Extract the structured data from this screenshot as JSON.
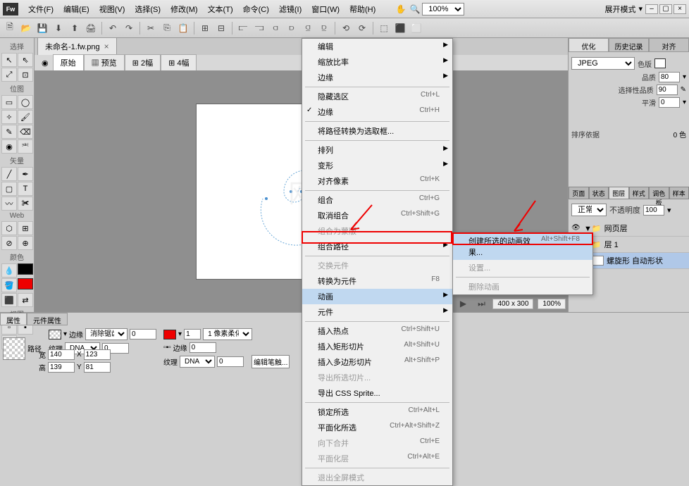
{
  "app": {
    "logo": "Fw"
  },
  "menubar": [
    "文件(F)",
    "编辑(E)",
    "视图(V)",
    "选择(S)",
    "修改(M)",
    "文本(T)",
    "命令(C)",
    "滤镜(I)",
    "窗口(W)",
    "帮助(H)"
  ],
  "titlebar_right": {
    "mode": "展开模式"
  },
  "zoom": "100%",
  "document": {
    "tab_name": "未命名-1.fw.png",
    "view_tabs": [
      "原始",
      "预览",
      "2幅",
      "4幅"
    ]
  },
  "left_sections": {
    "select": "选择",
    "bitmap": "位图",
    "vector": "矢量",
    "web": "Web",
    "colors": "颜色",
    "view": "视图"
  },
  "context_menu": [
    {
      "label": "编辑",
      "arrow": true
    },
    {
      "label": "缩放比率",
      "arrow": true
    },
    {
      "label": "边缘",
      "arrow": true
    },
    {
      "sep": true
    },
    {
      "label": "隐藏选区",
      "shortcut": "Ctrl+L"
    },
    {
      "label": "边缘",
      "shortcut": "Ctrl+H",
      "check": true
    },
    {
      "sep": true
    },
    {
      "label": "将路径转换为选取框..."
    },
    {
      "sep": true
    },
    {
      "label": "排列",
      "arrow": true
    },
    {
      "label": "变形",
      "arrow": true
    },
    {
      "label": "对齐像素",
      "shortcut": "Ctrl+K"
    },
    {
      "sep": true
    },
    {
      "label": "组合",
      "shortcut": "Ctrl+G"
    },
    {
      "label": "取消组合",
      "shortcut": "Ctrl+Shift+G"
    },
    {
      "label": "组合为蒙版",
      "disabled": true
    },
    {
      "label": "组合路径",
      "arrow": true
    },
    {
      "sep": true
    },
    {
      "label": "交换元件",
      "disabled": true
    },
    {
      "label": "转换为元件",
      "shortcut": "F8"
    },
    {
      "label": "动画",
      "arrow": true,
      "highlighted": true
    },
    {
      "label": "元件",
      "arrow": true
    },
    {
      "sep": true
    },
    {
      "label": "插入热点",
      "shortcut": "Ctrl+Shift+U"
    },
    {
      "label": "插入矩形切片",
      "shortcut": "Alt+Shift+U"
    },
    {
      "label": "插入多边形切片",
      "shortcut": "Alt+Shift+P"
    },
    {
      "label": "导出所选切片...",
      "disabled": true
    },
    {
      "label": "导出 CSS Sprite..."
    },
    {
      "sep": true
    },
    {
      "label": "锁定所选",
      "shortcut": "Ctrl+Alt+L"
    },
    {
      "label": "平面化所选",
      "shortcut": "Ctrl+Alt+Shift+Z"
    },
    {
      "label": "向下合并",
      "shortcut": "Ctrl+E",
      "disabled": true
    },
    {
      "label": "平面化层",
      "shortcut": "Ctrl+Alt+E",
      "disabled": true
    },
    {
      "sep": true
    },
    {
      "label": "退出全屏模式",
      "disabled": true
    }
  ],
  "submenu": [
    {
      "label": "创建所选的动画效果...",
      "shortcut": "Alt+Shift+F8",
      "highlighted": true
    },
    {
      "label": "设置...",
      "disabled": true
    },
    {
      "sep": true
    },
    {
      "label": "删除动画",
      "disabled": true
    }
  ],
  "right_panel": {
    "tabs": [
      "优化",
      "历史记录",
      "对齐"
    ],
    "format": "JPEG",
    "color_label": "色版",
    "quality_label": "品质",
    "quality": "80",
    "select_quality_label": "选择性品质",
    "select_quality": "90",
    "smooth_label": "平滑",
    "smooth": "0",
    "sort_label": "排序依据",
    "sort_colors": "0 色",
    "layer_tabs": [
      "页面",
      "状态",
      "图层",
      "样式",
      "调色板",
      "样本"
    ],
    "blend_mode": "正常",
    "opacity_label": "不透明度",
    "opacity": "100",
    "layers": [
      {
        "name": "网页层"
      },
      {
        "name": "层 1"
      },
      {
        "name": "螺旋形 自动形状"
      }
    ]
  },
  "bottom": {
    "tabs": [
      "属性",
      "元件属性"
    ],
    "path_label": "路径",
    "edge_label": "边缘",
    "edge_value": "消除锯齿",
    "edge_num": "0",
    "texture_label": "纹理",
    "texture_value": "DNA",
    "texture_num": "0",
    "stroke_size": "1",
    "stroke_soft": "1 像素柔化",
    "edge2_label": "边缘",
    "edge2_num": "0",
    "texture2_label": "纹理",
    "texture2_value": "DNA",
    "texture2_num": "0",
    "edit_brush": "编辑笔触...",
    "w_label": "宽",
    "w": "140",
    "x_label": "X",
    "x": "123",
    "h_label": "高",
    "h": "139",
    "y_label": "Y",
    "y": "81"
  },
  "status": {
    "dims": "400 x 300",
    "zoom": "100%"
  }
}
